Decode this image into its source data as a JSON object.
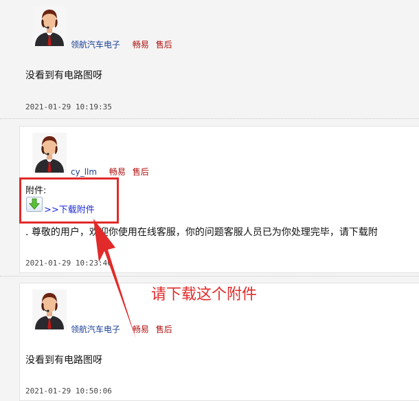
{
  "posts": [
    {
      "username": "领航汽车电子",
      "agent_name": "畅易",
      "agent_role": "售后",
      "message": "没看到有电路图呀",
      "timestamp": "2021-01-29 10:19:35"
    },
    {
      "username": "cy_llm",
      "agent_name": "畅易",
      "agent_role": "售后",
      "attachment_label": "附件:",
      "download_link": ">>下载附件",
      "message": ". 尊敬的用户，欢迎你使用在线客服，你的问题客服人员已为你处理完毕，请下载附",
      "timestamp": "2021-01-29 10:23:40"
    },
    {
      "username": "领航汽车电子",
      "agent_name": "畅易",
      "agent_role": "售后",
      "message": "没看到有电路图呀",
      "timestamp": "2021-01-29 10:50:06"
    }
  ],
  "annotation": {
    "text": "请下载这个附件",
    "color": "#e22a2a"
  },
  "colors": {
    "username": "#1a3f96",
    "role": "#b01010",
    "link": "#1d2bd6"
  }
}
